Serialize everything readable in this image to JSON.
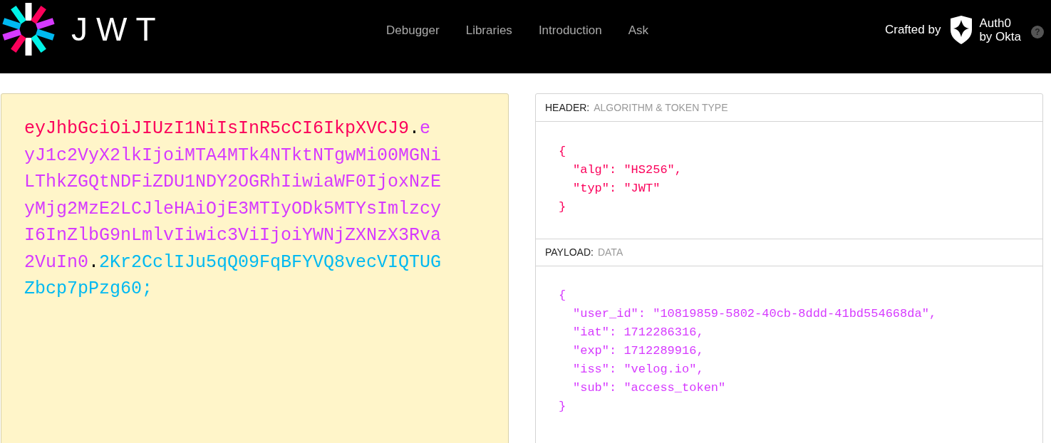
{
  "brand": {
    "wordmark": "JWT"
  },
  "nav": [
    {
      "label": "Debugger"
    },
    {
      "label": "Libraries"
    },
    {
      "label": "Introduction"
    },
    {
      "label": "Ask"
    }
  ],
  "credit": {
    "label": "Crafted by",
    "company_line1": "Auth0",
    "company_line2": "by Okta",
    "help": "?"
  },
  "encoded": [
    {
      "kind": "header",
      "text": "eyJhbGciOiJIUzI1NiIsInR5cCI6IkpXVCJ9"
    },
    {
      "kind": "dot",
      "text": "."
    },
    {
      "kind": "payload",
      "text": "eyJ1c2VyX2lkIjoiMTA4MTk4NTktNTgwMi00MGNiLThkZGQtNDFiZDU1NDY2OGRhIiwiaWF0IjoxNzEyMjg2MzE2LCJleHAiOjE3MTIyODk5MTYsImlzcyI6InZlbG9nLmlvIiwic3ViIjoiYWNjZXNzX3Rva2VuIn0"
    },
    {
      "kind": "dot",
      "text": "."
    },
    {
      "kind": "signature",
      "text": "2Kr2CclIJu5qQ09FqBFYVQ8vecVIQTUGZbcp7pPzg60;"
    }
  ],
  "sections": [
    {
      "kind": "header",
      "title": "HEADER:",
      "subtitle": "ALGORITHM & TOKEN TYPE",
      "lines": [
        {
          "kind": "brace",
          "text": "{"
        },
        {
          "kind": "field",
          "text": "\"alg\": \"HS256\","
        },
        {
          "kind": "field",
          "text": "\"typ\": \"JWT\""
        },
        {
          "kind": "brace",
          "text": "}"
        }
      ]
    },
    {
      "kind": "payload",
      "title": "PAYLOAD:",
      "subtitle": "DATA",
      "lines": [
        {
          "kind": "brace",
          "text": "{"
        },
        {
          "kind": "field",
          "text": "\"user_id\": \"10819859-5802-40cb-8ddd-41bd554668da\","
        },
        {
          "kind": "field",
          "text": "\"iat\": 1712286316,"
        },
        {
          "kind": "field",
          "text": "\"exp\": 1712289916,"
        },
        {
          "kind": "field",
          "text": "\"iss\": \"velog.io\","
        },
        {
          "kind": "field",
          "text": "\"sub\": \"access_token\""
        },
        {
          "kind": "brace",
          "text": "}"
        }
      ]
    }
  ]
}
